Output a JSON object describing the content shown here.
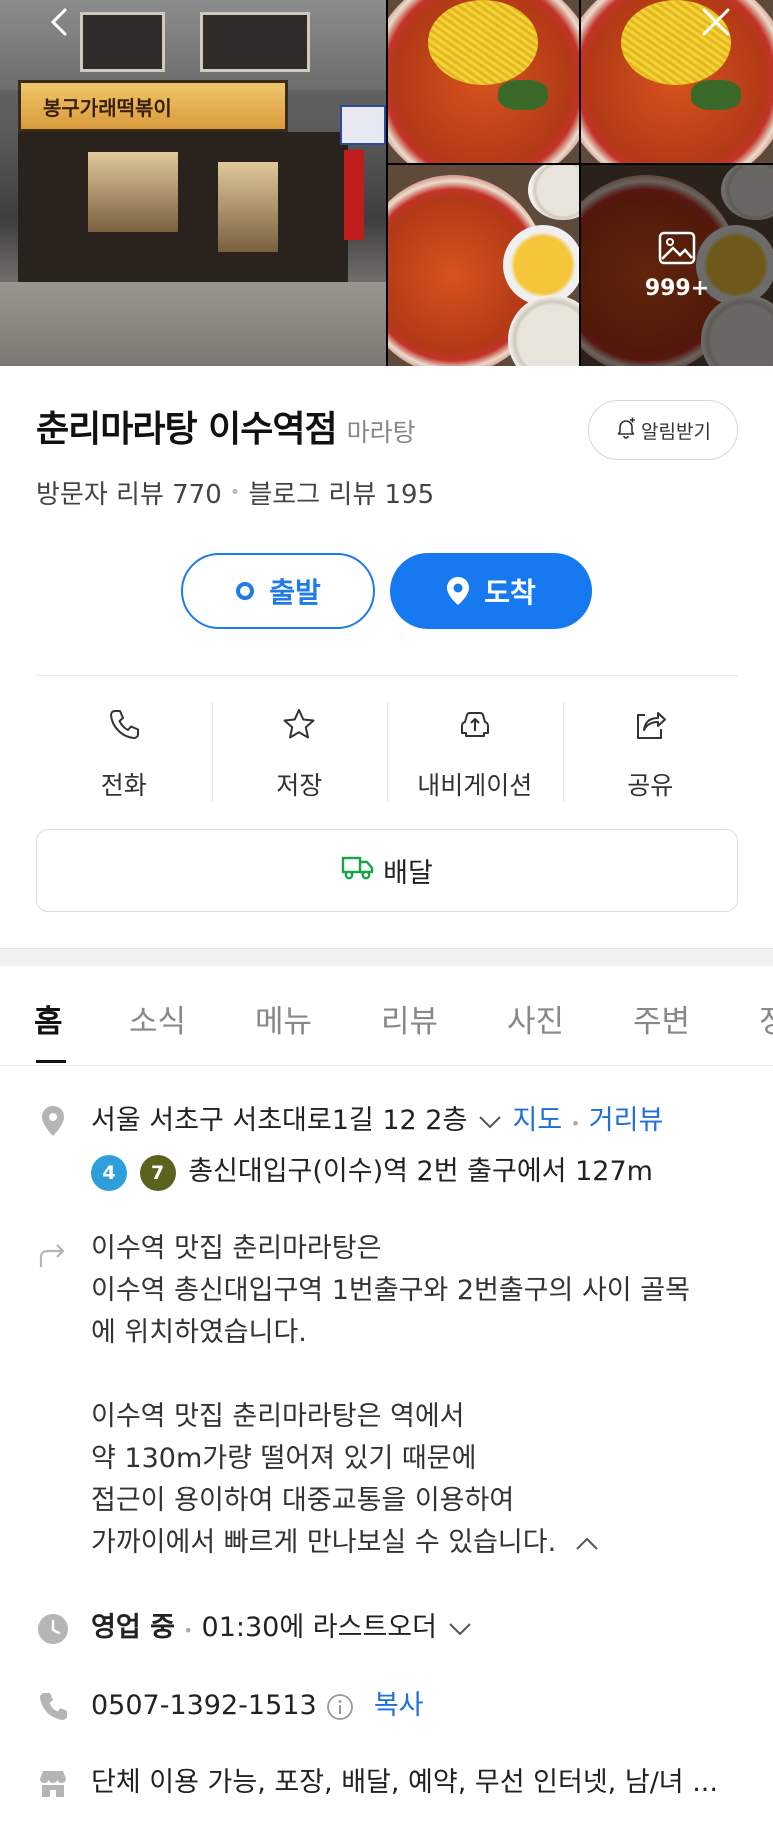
{
  "photos": {
    "storefront_sign": "봉구가래떡볶이",
    "more_count": "999+"
  },
  "place": {
    "name": "춘리마라탕 이수역점",
    "category": "마라탕",
    "alert_label": "알림받기",
    "visitor_reviews": "방문자 리뷰 770",
    "blog_reviews": "블로그 리뷰 195"
  },
  "route": {
    "start_label": "출발",
    "arrive_label": "도착"
  },
  "actions": [
    {
      "label": "전화",
      "icon": "phone-icon"
    },
    {
      "label": "저장",
      "icon": "star-icon"
    },
    {
      "label": "내비게이션",
      "icon": "navigation-icon"
    },
    {
      "label": "공유",
      "icon": "share-icon"
    }
  ],
  "delivery_label": "배달",
  "tabs": [
    "홈",
    "소식",
    "메뉴",
    "리뷰",
    "사진",
    "주변",
    "정"
  ],
  "info": {
    "address": "서울 서초구 서초대로1길 12 2층",
    "map_link": "지도",
    "street_view_link": "거리뷰",
    "subway_lines": [
      "4",
      "7"
    ],
    "subway_text": "총신대입구(이수)역 2번 출구에서 127m",
    "description": [
      "이수역 맛집 춘리마라탕은",
      "이수역 총신대입구역 1번출구와 2번출구의 사이 골목",
      "에 위치하였습니다.",
      "",
      "이수역 맛집 춘리마라탕은 역에서",
      "약 130m가량 떨어져 있기 때문에",
      "접근이 용이하여 대중교통을 이용하여",
      "가까이에서 빠르게 만나보실 수 있습니다."
    ],
    "hours_status": "영업 중",
    "hours_detail": "01:30에 라스트오더",
    "phone": "0507-1392-1513",
    "copy_label": "복사",
    "amenities": "단체 이용 가능, 포장, 배달, 예약, 무선 인터넷, 남/녀 ..."
  },
  "colors": {
    "accent": "#1779f0",
    "subway_line_4": "#2f9fdc",
    "subway_line_7": "#5b621e"
  }
}
